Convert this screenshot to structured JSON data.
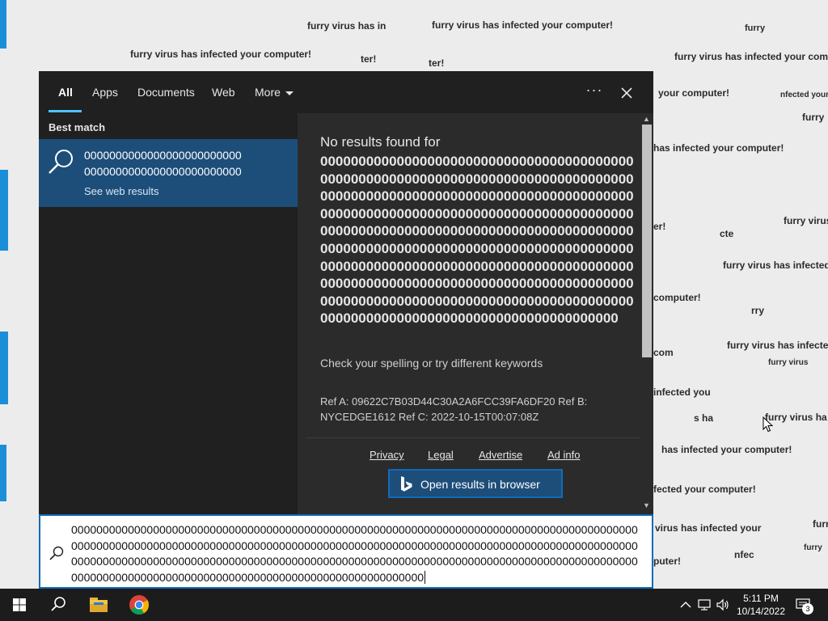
{
  "desktop": {
    "scatter_texts": [
      "furry virus has in",
      "furry virus has infected your computer!",
      "furry",
      "furry virus has infected your computer!",
      "ter!",
      "ter!",
      "furry virus has infected your comp",
      "your computer!",
      "nfected your",
      "furry",
      "has infected your computer!",
      "furry virus",
      "er!",
      "cte",
      "furry virus has infected",
      "computer!",
      "rry",
      "com",
      "furry virus has infecte",
      "furry virus",
      "infected you",
      "s ha",
      "furry virus ha",
      "has infected your computer!",
      "fected your computer!",
      "furr",
      "virus has infected your",
      "nfec",
      "furry",
      "puter!",
      "furry virus has infected your computer.",
      "furry virus has infected your computer"
    ]
  },
  "search_panel": {
    "tabs": [
      "All",
      "Apps",
      "Documents",
      "Web",
      "More"
    ],
    "more_options_label": "···",
    "best_match_label": "Best match",
    "best_match_line1": "0000000000000000000000000",
    "best_match_line2": "0000000000000000000000000",
    "best_match_sub": "See web results",
    "no_results_title": "No results found for",
    "no_results_query": "000000000000000000000000000000000000000000000000000000000000000000000000000000000000000000000000000000000000000000000000000000000000000000000000000000000000000000000000000000000000000000000000000000000000000000000000000000000000000000000000000000000000000000000000000000000000000000000000000000000000000000000000000000000000000000000000000000000000000000000000000000000000000000000000000000000000000000000000",
    "spell_hint": "Check your spelling or try different keywords",
    "ref_info": "Ref A: 09622C7B03D44C30A2A6FCC39FA6DF20 Ref B: NYCEDGE1612 Ref C: 2022-10-15T00:07:08Z",
    "footer_links": [
      "Privacy",
      "Legal",
      "Advertise",
      "Ad info"
    ],
    "open_browser_label": "Open results in browser"
  },
  "search_box": {
    "value": "00000000000000000000000000000000000000000000000000000000000000000000000000000000000000000000000000000000000000000000000000000000000000000000000000000000000000000000000000000000000000000000000000000000000000000000000000000000000000000000000000000000000000000000000000000000000000000000000000000000000000000000000000000000000000"
  },
  "taskbar": {
    "time": "5:11 PM",
    "date": "10/14/2022",
    "notification_count": "3"
  },
  "colors": {
    "accent": "#0f6bb8",
    "selection": "#1d4e7a",
    "panel_bg": "#2b2b2b",
    "taskbar_bg": "#1c1c1c"
  }
}
